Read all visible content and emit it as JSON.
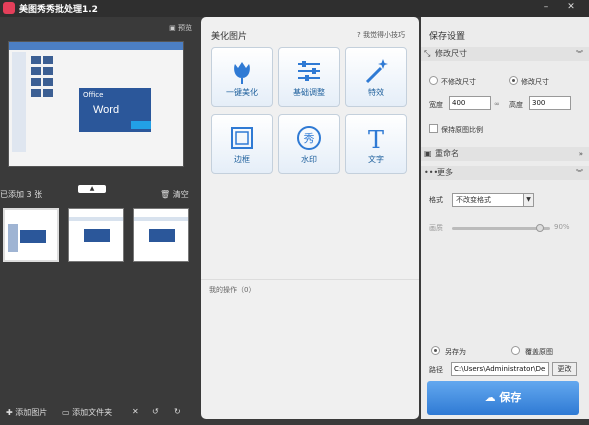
{
  "app": {
    "title": "美图秀秀批处理1.2"
  },
  "preview": {
    "label": "预览",
    "word_brand": "Office",
    "word_label": "Word"
  },
  "left": {
    "count_label": "已添加 3 张",
    "clear_label": "清空",
    "add_image": "添加图片",
    "add_folder": "添加文件夹"
  },
  "mid": {
    "title": "美化图片",
    "tip": "我觉得小技巧",
    "tools": [
      {
        "label": "一键美化",
        "icon": "tulip-icon"
      },
      {
        "label": "基础调整",
        "icon": "sliders-icon"
      },
      {
        "label": "特效",
        "icon": "magic-wand-icon"
      },
      {
        "label": "边框",
        "icon": "frame-icon"
      },
      {
        "label": "水印",
        "icon": "watermark-icon"
      },
      {
        "label": "文字",
        "icon": "text-icon"
      }
    ],
    "ops_title": "我的操作（0）"
  },
  "right": {
    "title": "保存设置",
    "resize": {
      "header": "修改尺寸",
      "keep_size": "不修改尺寸",
      "modify_size": "修改尺寸",
      "width_label": "宽度",
      "width_value": "400",
      "height_label": "高度",
      "height_value": "300",
      "keep_ratio": "保持原图比例"
    },
    "rename": {
      "header": "重命名"
    },
    "more": {
      "header": "更多",
      "format_label": "格式",
      "format_value": "不改变格式",
      "quality_label": "画质",
      "quality_value": "90%",
      "quality_level": 0.9
    },
    "save_as": "另存为",
    "overwrite": "覆盖原图",
    "path_label": "路径",
    "path_value": "C:\\Users\\Administrator\\De",
    "browse": "更改",
    "save_button": "保存"
  },
  "colors": {
    "accent": "#3b88e0",
    "header_bg": "#2f2f2f",
    "word_blue": "#2b579a"
  }
}
